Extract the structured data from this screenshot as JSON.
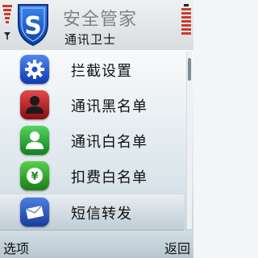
{
  "header": {
    "title": "安全管家",
    "subtitle": "通讯卫士",
    "logo_icon": "shield-s-logo",
    "signal_icon": "signal-strength-icon",
    "battery_icon": "battery-level-icon"
  },
  "menu": {
    "items": [
      {
        "label": "拦截设置",
        "icon": "gear-icon",
        "color": "#1d4fd0"
      },
      {
        "label": "通讯黑名单",
        "icon": "person-icon",
        "color": "#b3121c"
      },
      {
        "label": "通讯白名单",
        "icon": "person-icon",
        "color": "#1c9a2a"
      },
      {
        "label": "扣费白名单",
        "icon": "yen-coin-icon",
        "color": "#2d9a22"
      },
      {
        "label": "短信转发",
        "icon": "envelope-icon",
        "color": "#2a4fb0"
      }
    ],
    "selected_index": 4
  },
  "softkeys": {
    "left": "选项",
    "right": "返回"
  },
  "colors": {
    "accent": "#1d5fd6",
    "signal": "#d13a2e"
  }
}
